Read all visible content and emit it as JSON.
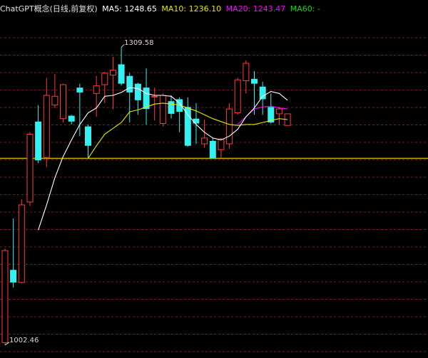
{
  "title": "ChatGPT概念(日线,前复权)",
  "ma_legend": [
    {
      "label": "MA5: 1248.65",
      "color": "#ffffff"
    },
    {
      "label": "MA10: 1236.10",
      "color": "#e8e800"
    },
    {
      "label": "MA20: 1243.47",
      "color": "#ff00ff"
    },
    {
      "label": "MA60: -",
      "color": "#00e000"
    }
  ],
  "colors": {
    "background": "#000000",
    "up": "#ff3a3a",
    "down": "#35f0f0",
    "grid": "#7a1d1d",
    "ma5": "#ffffff",
    "ma10": "#e8e800",
    "ma20": "#ff00ff",
    "reference_line": "#c8b400",
    "title": "#e0e0e0"
  },
  "chart_data": {
    "type": "candlestick",
    "title": "ChatGPT概念(日线,前复权)",
    "ylim": [
      995,
      1340
    ],
    "high_label": "1309.58",
    "low_label": "1002.46",
    "high_value": 1309.58,
    "low_value": 1002.46,
    "reference_level": 1195,
    "candles": [
      {
        "o": 1005,
        "c": 1100,
        "h": 1102,
        "l": 1002.46
      },
      {
        "o": 1080,
        "c": 1067,
        "h": 1133,
        "l": 1062
      },
      {
        "o": 1067,
        "c": 1147,
        "h": 1153,
        "l": 1066
      },
      {
        "o": 1150,
        "c": 1220,
        "h": 1222,
        "l": 1146
      },
      {
        "o": 1233,
        "c": 1193,
        "h": 1250,
        "l": 1190
      },
      {
        "o": 1196,
        "c": 1260,
        "h": 1278,
        "l": 1186
      },
      {
        "o": 1250,
        "c": 1259,
        "h": 1282,
        "l": 1247
      },
      {
        "o": 1236,
        "c": 1271,
        "h": 1272,
        "l": 1232
      },
      {
        "o": 1239,
        "c": 1233,
        "h": 1240,
        "l": 1230
      },
      {
        "o": 1268,
        "c": 1263,
        "h": 1272,
        "l": 1218
      },
      {
        "o": 1228,
        "c": 1208,
        "h": 1230,
        "l": 1195
      },
      {
        "o": 1262,
        "c": 1270,
        "h": 1280,
        "l": 1238
      },
      {
        "o": 1271,
        "c": 1283,
        "h": 1284,
        "l": 1252
      },
      {
        "o": 1281,
        "c": 1286,
        "h": 1300,
        "l": 1246
      },
      {
        "o": 1292,
        "c": 1272,
        "h": 1309.58,
        "l": 1270
      },
      {
        "o": 1280,
        "c": 1263,
        "h": 1283,
        "l": 1232
      },
      {
        "o": 1272,
        "c": 1255,
        "h": 1273,
        "l": 1240
      },
      {
        "o": 1268,
        "c": 1246,
        "h": 1288,
        "l": 1230
      },
      {
        "o": 1259,
        "c": 1259,
        "h": 1268,
        "l": 1234
      },
      {
        "o": 1231,
        "c": 1260,
        "h": 1262,
        "l": 1228
      },
      {
        "o": 1254,
        "c": 1241,
        "h": 1260,
        "l": 1236
      },
      {
        "o": 1256,
        "c": 1243,
        "h": 1258,
        "l": 1222
      },
      {
        "o": 1248,
        "c": 1208,
        "h": 1258,
        "l": 1207
      },
      {
        "o": 1236,
        "c": 1231,
        "h": 1252,
        "l": 1210
      },
      {
        "o": 1210,
        "c": 1216,
        "h": 1235,
        "l": 1206
      },
      {
        "o": 1213,
        "c": 1195,
        "h": 1216,
        "l": 1195
      },
      {
        "o": 1204,
        "c": 1215,
        "h": 1216,
        "l": 1195
      },
      {
        "o": 1210,
        "c": 1246,
        "h": 1252,
        "l": 1205
      },
      {
        "o": 1242,
        "c": 1276,
        "h": 1278,
        "l": 1240
      },
      {
        "o": 1275,
        "c": 1293,
        "h": 1296,
        "l": 1262
      },
      {
        "o": 1277,
        "c": 1272,
        "h": 1285,
        "l": 1240
      },
      {
        "o": 1269,
        "c": 1256,
        "h": 1274,
        "l": 1240
      },
      {
        "o": 1248,
        "c": 1232,
        "h": 1262,
        "l": 1231
      },
      {
        "o": 1241,
        "c": 1246,
        "h": 1248,
        "l": 1230
      },
      {
        "o": 1229,
        "c": 1241,
        "h": 1241,
        "l": 1229
      }
    ],
    "ma5": [
      null,
      null,
      null,
      null,
      1121,
      1147,
      1175,
      1197,
      1214,
      1230,
      1242,
      1247,
      1259,
      1260,
      1263,
      1268,
      1267,
      1262,
      1260,
      1260,
      1259,
      1252,
      1240,
      1230,
      1222,
      1216,
      1214,
      1218,
      1225,
      1238,
      1247,
      1259,
      1264,
      1262,
      1255
    ],
    "ma10": [
      null,
      null,
      null,
      null,
      null,
      null,
      null,
      null,
      null,
      null,
      1195,
      1208,
      1220,
      1226,
      1232,
      1243,
      1245,
      1248,
      1251,
      1252,
      1251,
      1250,
      1247,
      1244,
      1240,
      1236,
      1233,
      1230,
      1229,
      1230,
      1230,
      1232,
      1234,
      1236,
      1235
    ],
    "ma20": [
      null,
      null,
      null,
      null,
      null,
      null,
      null,
      null,
      null,
      null,
      null,
      null,
      null,
      null,
      null,
      null,
      null,
      null,
      null,
      null,
      null,
      null,
      null,
      null,
      null,
      null,
      null,
      null,
      1230,
      1238,
      1246,
      1248,
      1249,
      1247,
      1246
    ]
  }
}
